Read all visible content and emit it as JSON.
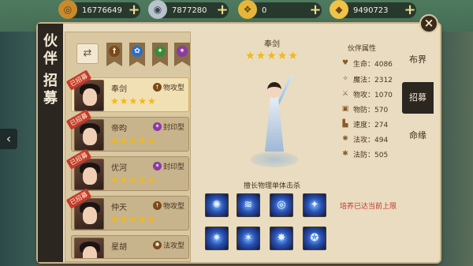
{
  "resources": [
    {
      "id": "coin",
      "value": "16776649",
      "color": "#c98a2c"
    },
    {
      "id": "silver",
      "value": "7877280",
      "color": "#b8c2cc"
    },
    {
      "id": "ingot",
      "value": "0",
      "color": "#e6b53a"
    },
    {
      "id": "gold",
      "value": "9490723",
      "color": "#f0c24a"
    }
  ],
  "background": {
    "arrow": "‹"
  },
  "panel": {
    "title_chars": [
      "伙",
      "伴",
      "招",
      "募"
    ],
    "close_label": "×"
  },
  "filters": [
    {
      "id": "swap",
      "icon": "swap-icon",
      "glyph": "⇄"
    },
    {
      "id": "attack",
      "icon": "sword-icon",
      "glyph": "†",
      "color": "#7a4a18"
    },
    {
      "id": "magic",
      "icon": "potion-icon",
      "glyph": "✿",
      "color": "#2a6ec8"
    },
    {
      "id": "support",
      "icon": "leaf-icon",
      "glyph": "✦",
      "color": "#3a8a3a"
    },
    {
      "id": "seal",
      "icon": "star-seal-icon",
      "glyph": "✶",
      "color": "#8a3aa0"
    }
  ],
  "partners": [
    {
      "name": "奉剑",
      "type": "物攻型",
      "type_color": "#7a4a18",
      "stars": 5,
      "tag": "已招募",
      "selected": true
    },
    {
      "name": "帝昀",
      "type": "封印型",
      "type_color": "#8a3aa0",
      "stars": 5,
      "tag": "已招募",
      "selected": false
    },
    {
      "name": "优河",
      "type": "封印型",
      "type_color": "#8a3aa0",
      "stars": 5,
      "tag": "已招募",
      "selected": false
    },
    {
      "name": "仲天",
      "type": "物攻型",
      "type_color": "#7a4a18",
      "stars": 5,
      "tag": "已招募",
      "selected": false
    },
    {
      "name": "星胡",
      "type": "法攻型",
      "type_color": "#7a4a18",
      "stars": 5,
      "tag": "",
      "selected": false
    }
  ],
  "hero": {
    "name": "奉剑",
    "stars": 5,
    "specialty": "擅长物理单体击杀"
  },
  "skills": [
    "✺",
    "≋",
    "◎",
    "✦",
    "✷",
    "✶",
    "✸",
    "✪"
  ],
  "attributes": {
    "title": "伙伴属性",
    "rows": [
      {
        "icon": "heart-icon",
        "glyph": "♥",
        "text": "生命：4086"
      },
      {
        "icon": "magic-icon",
        "glyph": "✧",
        "text": "魔法：2312"
      },
      {
        "icon": "sword-icon",
        "glyph": "⚔",
        "text": "物攻：1070"
      },
      {
        "icon": "shield-icon",
        "glyph": "▣",
        "text": "物防：570"
      },
      {
        "icon": "boot-icon",
        "glyph": "▙",
        "text": "速度：274"
      },
      {
        "icon": "spell-icon",
        "glyph": "✺",
        "text": "法攻：494"
      },
      {
        "icon": "ward-icon",
        "glyph": "✱",
        "text": "法防：505"
      }
    ],
    "cap_note": "培养已达当前上限"
  },
  "tabs": [
    {
      "label": "布界",
      "active": false
    },
    {
      "label": "招募",
      "active": true
    },
    {
      "label": "命缘",
      "active": false
    }
  ]
}
